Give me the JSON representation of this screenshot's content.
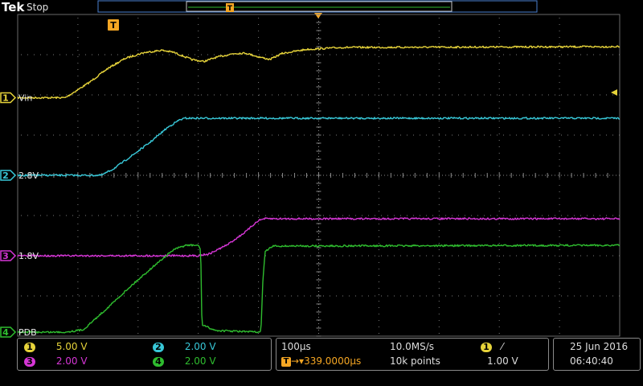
{
  "header": {
    "brand": "Tek",
    "status": "Stop",
    "trigger_marker": "T"
  },
  "colors": {
    "ch1": "#e6d33a",
    "ch2": "#38c8d8",
    "ch3": "#d636d6",
    "ch4": "#2fbd2f",
    "trigger": "#f5a623",
    "grid": "#6a6a6a"
  },
  "chart_data": {
    "type": "line",
    "x_unit": "s",
    "xlim": [
      -0.000339,
      0.000661
    ],
    "x_div": 0.0001,
    "grid": true,
    "series": [
      {
        "name": "Vin",
        "channel": "1",
        "volts_per_div": 5.0,
        "ref_label": "Vin",
        "ref_div": 1.93,
        "points": [
          [
            -0.000339,
            0
          ],
          [
            -0.00026,
            0
          ],
          [
            -0.00022,
            1.9
          ],
          [
            -0.00019,
            3.6
          ],
          [
            -0.00016,
            4.9
          ],
          [
            -0.00013,
            5.6
          ],
          [
            -0.0001,
            5.9
          ],
          [
            -8e-05,
            5.65
          ],
          [
            -5e-05,
            4.75
          ],
          [
            -3e-05,
            4.5
          ],
          [
            -1e-05,
            5.0
          ],
          [
            2e-05,
            5.5
          ],
          [
            4e-05,
            5.55
          ],
          [
            6e-05,
            5.1
          ],
          [
            8e-05,
            4.75
          ],
          [
            0.0001,
            5.5
          ],
          [
            0.00014,
            6.0
          ],
          [
            0.0002,
            6.25
          ],
          [
            0.000661,
            6.35
          ]
        ]
      },
      {
        "name": "2.8V",
        "channel": "2",
        "volts_per_div": 2.0,
        "ref_label": "2.8V",
        "ref_div": 0,
        "points": [
          [
            -0.000339,
            0
          ],
          [
            -0.0002,
            0
          ],
          [
            -0.00018,
            0.32
          ],
          [
            -0.00015,
            0.96
          ],
          [
            -0.00012,
            1.62
          ],
          [
            -9e-05,
            2.38
          ],
          [
            -7e-05,
            2.76
          ],
          [
            -6e-05,
            2.84
          ],
          [
            0.000661,
            2.84
          ]
        ]
      },
      {
        "name": "1.8V",
        "channel": "3",
        "volts_per_div": 2.0,
        "ref_label": "1.8V",
        "ref_div": -2.0,
        "points": [
          [
            -0.000339,
            0
          ],
          [
            -4e-05,
            0
          ],
          [
            -2e-05,
            0.1
          ],
          [
            1e-05,
            0.56
          ],
          [
            4e-05,
            1.2
          ],
          [
            6e-05,
            1.74
          ],
          [
            7e-05,
            1.84
          ],
          [
            0.000661,
            1.84
          ]
        ]
      },
      {
        "name": "PDB",
        "channel": "4",
        "volts_per_div": 2.0,
        "ref_label": "PDB",
        "ref_div": -3.9,
        "points": [
          [
            -0.000339,
            0
          ],
          [
            -0.00026,
            0
          ],
          [
            -0.00023,
            0.12
          ],
          [
            -0.00019,
            1.2
          ],
          [
            -0.00015,
            2.32
          ],
          [
            -0.00011,
            3.36
          ],
          [
            -8e-05,
            4.1
          ],
          [
            -6e-05,
            4.32
          ],
          [
            -4e-05,
            4.32
          ],
          [
            -3.5e-05,
            4.15
          ],
          [
            -3.3e-05,
            0.36
          ],
          [
            -1e-05,
            0.08
          ],
          [
            6e-05,
            0
          ],
          [
            6.5e-05,
            0
          ],
          [
            6.8e-05,
            2.4
          ],
          [
            7.2e-05,
            4.0
          ],
          [
            8.5e-05,
            4.28
          ],
          [
            0.000661,
            4.32
          ]
        ]
      }
    ]
  },
  "readout": {
    "ch1_num": "1",
    "ch1_scale": "5.00 V",
    "ch2_num": "2",
    "ch2_scale": "2.00 V",
    "ch3_num": "3",
    "ch3_scale": "2.00 V",
    "ch4_num": "4",
    "ch4_scale": "2.00 V",
    "timebase": "100µs",
    "sample_rate": "10.0MS/s",
    "trig_delay": "339.0000µs",
    "record_length": "10k points",
    "trig_channel": "1",
    "trig_slope": "⁄",
    "trig_level": "1.00 V",
    "date": "25 Jun  2016",
    "time": "06:40:40"
  }
}
